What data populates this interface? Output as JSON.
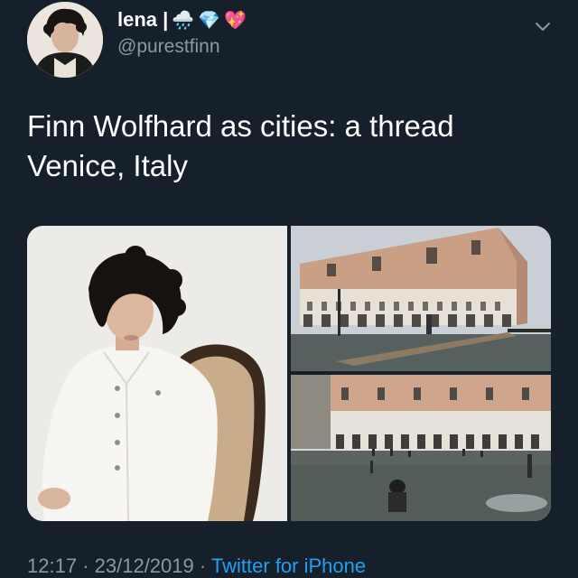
{
  "profile": {
    "display_name": "lena |",
    "emojis": [
      "🌧️",
      "💎",
      "💖"
    ],
    "handle": "@purestfinn"
  },
  "tweet": {
    "lines": [
      "Finn Wolfhard as cities: a thread",
      "Venice, Italy"
    ]
  },
  "media": {
    "photos": [
      {
        "name": "portrait-photo"
      },
      {
        "name": "doges-palace-photo"
      },
      {
        "name": "flooded-piazza-photo"
      }
    ]
  },
  "meta": {
    "time": "12:17",
    "date": "23/12/2019",
    "separator": "·",
    "source": "Twitter for iPhone"
  },
  "colors": {
    "background": "#15202b",
    "secondary_text": "#8899a6",
    "link": "#1da1f2"
  },
  "icons": {
    "more": "chevron-down-icon"
  }
}
